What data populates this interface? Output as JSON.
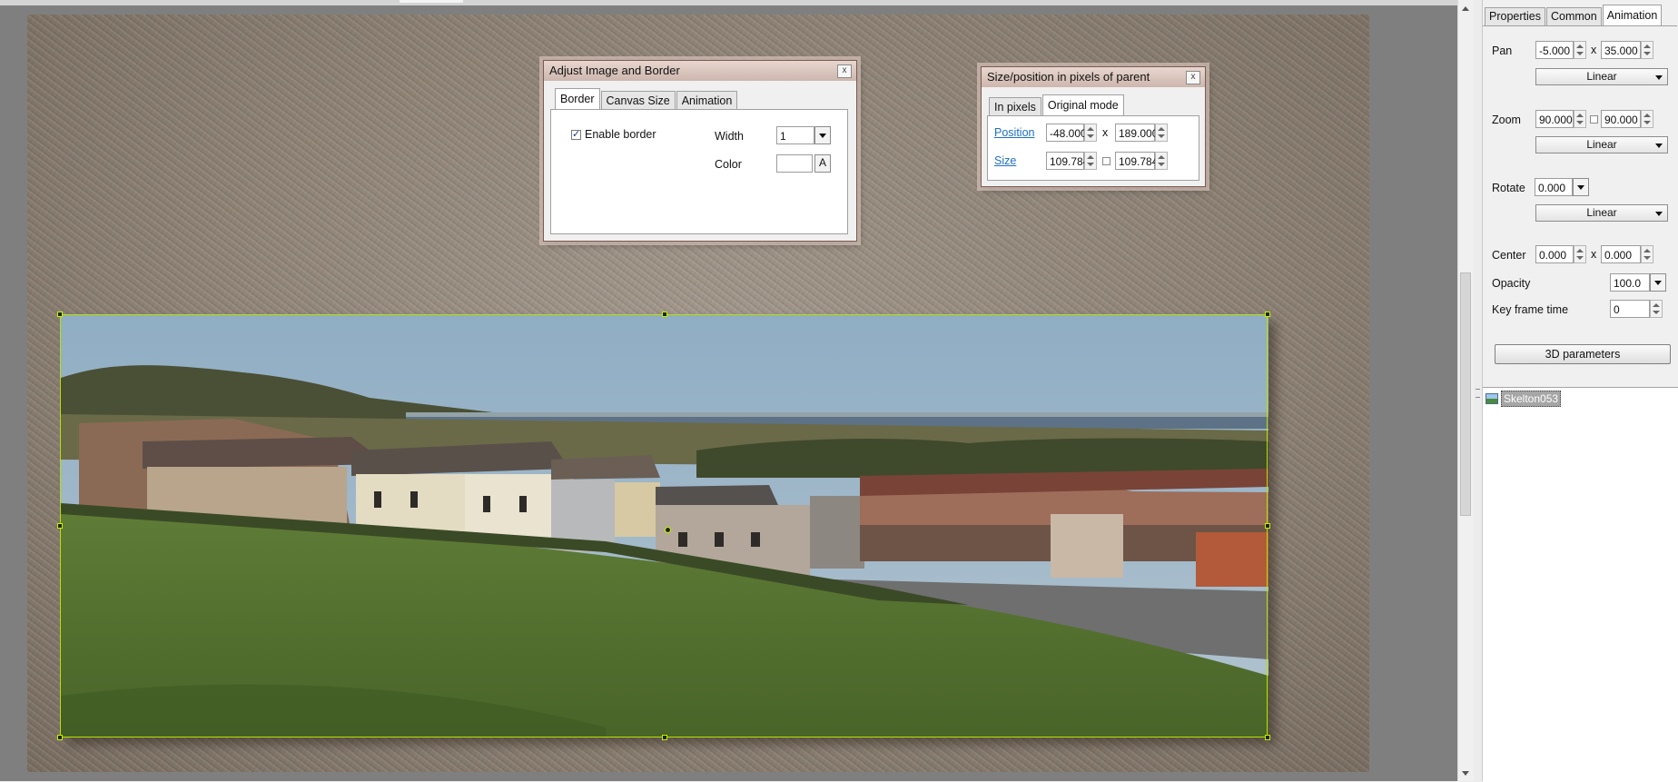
{
  "adjust_dialog": {
    "title": "Adjust Image and Border",
    "close_label": "x",
    "tabs": [
      "Border",
      "Canvas Size",
      "Animation"
    ],
    "active_tab": "Border",
    "enable_border_label": "Enable border",
    "enable_border_checked": true,
    "width_label": "Width",
    "width_value": "1",
    "color_label": "Color",
    "color_button_label": "A"
  },
  "size_dialog": {
    "title": "Size/position in pixels of parent",
    "close_label": "x",
    "tabs": [
      "In pixels",
      "Original mode"
    ],
    "active_tab": "Original mode",
    "position_label": "Position",
    "position_x": "-48.000",
    "position_sep": "x",
    "position_y": "189.000",
    "size_label": "Size",
    "size_w": "109.784",
    "size_h": "109.784"
  },
  "right_panel": {
    "tabs": [
      "Properties",
      "Common",
      "Animation"
    ],
    "active_tab": "Animation",
    "pan_label": "Pan",
    "pan_x": "-5.000",
    "pan_sep": "x",
    "pan_y": "35.000",
    "pan_mode": "Linear",
    "zoom_label": "Zoom",
    "zoom_x": "90.000",
    "zoom_y": "90.000",
    "zoom_mode": "Linear",
    "rotate_label": "Rotate",
    "rotate_value": "0.000",
    "rotate_mode": "Linear",
    "center_label": "Center",
    "center_x": "0.000",
    "center_sep": "x",
    "center_y": "0.000",
    "opacity_label": "Opacity",
    "opacity_value": "100.0",
    "keyframe_label": "Key frame time",
    "keyframe_value": "0",
    "params_button": "3D parameters"
  },
  "object_tree": {
    "items": [
      {
        "label": "Skelton053",
        "icon": "image-icon",
        "selected": true
      }
    ]
  },
  "colors": {
    "selection_border": "#b8e000",
    "link": "#1f6fc5"
  }
}
